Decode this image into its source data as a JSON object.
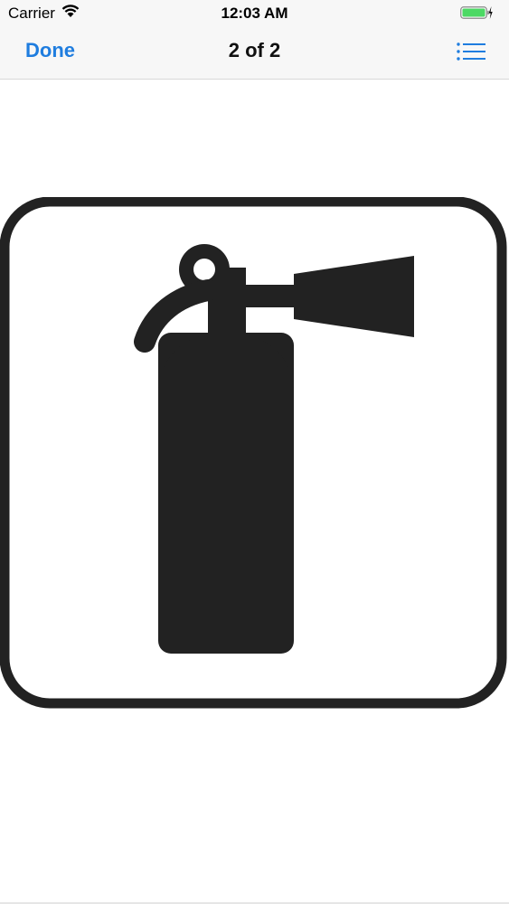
{
  "status_bar": {
    "carrier": "Carrier",
    "time": "12:03 AM",
    "wifi_icon": "wifi-icon",
    "battery_icon": "battery-charging-icon",
    "battery_color": "#4cd964"
  },
  "nav_bar": {
    "done_label": "Done",
    "title": "2 of 2",
    "list_icon": "list-icon",
    "accent_color": "#1f7ddf"
  },
  "content": {
    "image_icon": "fire-extinguisher-icon"
  }
}
